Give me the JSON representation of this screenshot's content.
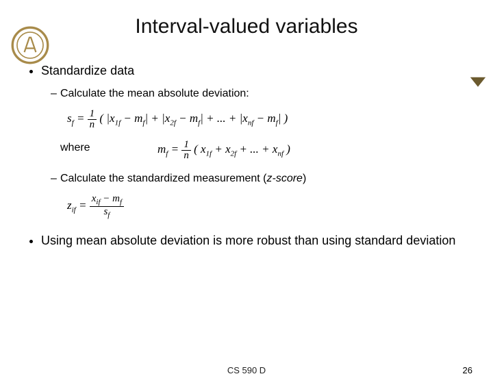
{
  "title": "Interval-valued variables",
  "bullet1": "Standardize data",
  "sub1": "Calculate the mean absolute deviation:",
  "formula1": "s_f = (1/n)( |x_{1f} − m_f| + |x_{2f} − m_f| + ... + |x_{nf} − m_f| )",
  "where": "where",
  "formula2": "m_f = (1/n)( x_{1f} + x_{2f} + ... + x_{nf} )",
  "sub2": "Calculate the standardized measurement (",
  "sub2_emph": "z-score",
  "sub2_tail": ")",
  "formula3": "z_{if} = (x_{if} − m_f) / s_f",
  "bullet2": "Using mean absolute deviation is more robust than using standard deviation",
  "footer": "CS 590 D",
  "page": "26"
}
